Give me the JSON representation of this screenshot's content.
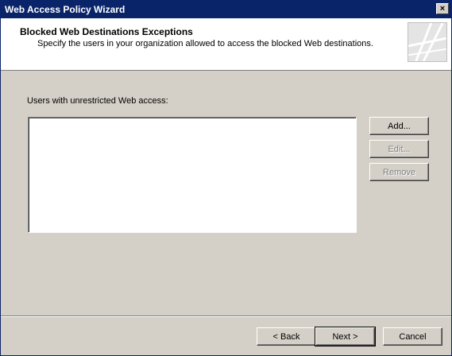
{
  "window": {
    "title": "Web Access Policy Wizard",
    "close_label": "×"
  },
  "header": {
    "title": "Blocked Web Destinations Exceptions",
    "subtitle": "Specify the users in your organization allowed to access the blocked Web destinations."
  },
  "content": {
    "list_label": "Users with unrestricted Web access:",
    "users": []
  },
  "buttons": {
    "add": "Add...",
    "edit": "Edit...",
    "remove": "Remove",
    "back": "< Back",
    "next": "Next >",
    "cancel": "Cancel"
  }
}
